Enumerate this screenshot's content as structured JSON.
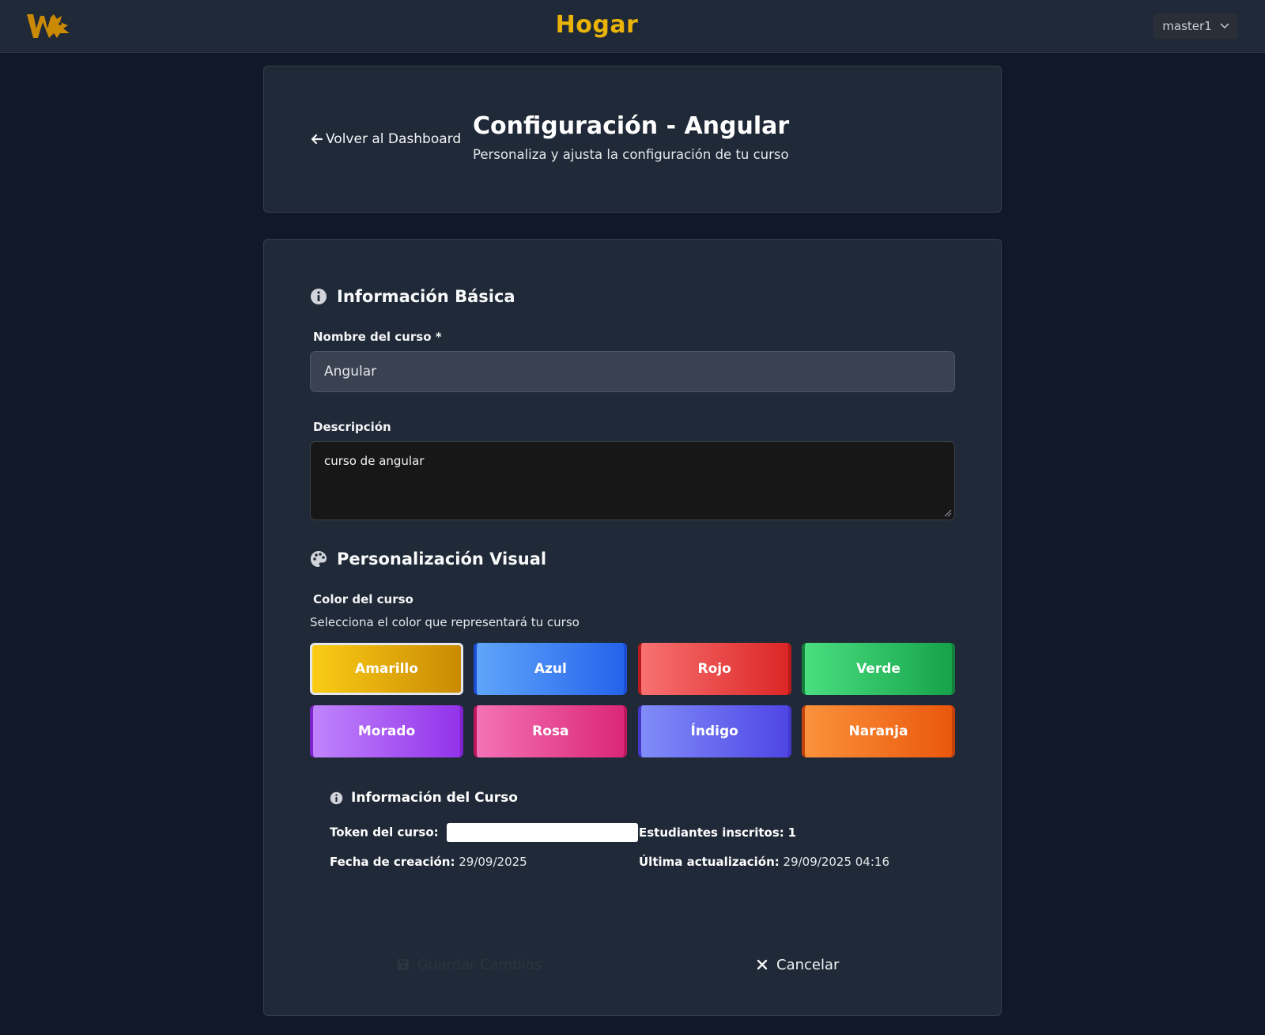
{
  "header": {
    "app_title": "Hogar",
    "user_menu_label": "master1"
  },
  "page": {
    "back_link": "Volver al Dashboard",
    "title": "Configuración - Angular",
    "subtitle": "Personaliza y ajusta la configuración de tu curso"
  },
  "basic_info": {
    "section_title": "Información Básica",
    "name_label": "Nombre del curso *",
    "name_value": "Angular",
    "description_label": "Descripción",
    "description_value": "curso de angular"
  },
  "visual": {
    "section_title": "Personalización Visual",
    "color_label": "Color del curso",
    "color_hint": "Selecciona el color que representará tu curso",
    "selected": "Amarillo",
    "colors": [
      {
        "label": "Amarillo",
        "from": "#facc15",
        "to": "#ca8a04",
        "edge": "#a16207"
      },
      {
        "label": "Azul",
        "from": "#60a5fa",
        "to": "#2563eb",
        "edge": "#1d4ed8"
      },
      {
        "label": "Rojo",
        "from": "#f87171",
        "to": "#dc2626",
        "edge": "#b91c1c"
      },
      {
        "label": "Verde",
        "from": "#4ade80",
        "to": "#16a34a",
        "edge": "#15803d"
      },
      {
        "label": "Morado",
        "from": "#c084fc",
        "to": "#9333ea",
        "edge": "#7e22ce"
      },
      {
        "label": "Rosa",
        "from": "#f472b6",
        "to": "#db2777",
        "edge": "#be185d"
      },
      {
        "label": "Índigo",
        "from": "#818cf8",
        "to": "#4f46e5",
        "edge": "#4338ca"
      },
      {
        "label": "Naranja",
        "from": "#fb923c",
        "to": "#ea580c",
        "edge": "#c2410c"
      }
    ]
  },
  "course_info": {
    "title": "Información del Curso",
    "token_label": "Token del curso:",
    "token_value": "",
    "students_label": "Estudiantes inscritos:",
    "students_value": "1",
    "created_label": "Fecha de creación:",
    "created_value": "29/09/2025",
    "updated_label": "Última actualización:",
    "updated_value": "29/09/2025 04:16"
  },
  "actions": {
    "save_label": "Guardar Cambios",
    "cancel_label": "Cancelar"
  },
  "icons": {
    "logo": "wolf-logo",
    "back": "arrow-left-icon",
    "info": "info-circle-icon",
    "palette": "palette-icon",
    "save": "floppy-disk-icon",
    "cancel": "close-icon",
    "chevron": "chevron-down-icon"
  }
}
